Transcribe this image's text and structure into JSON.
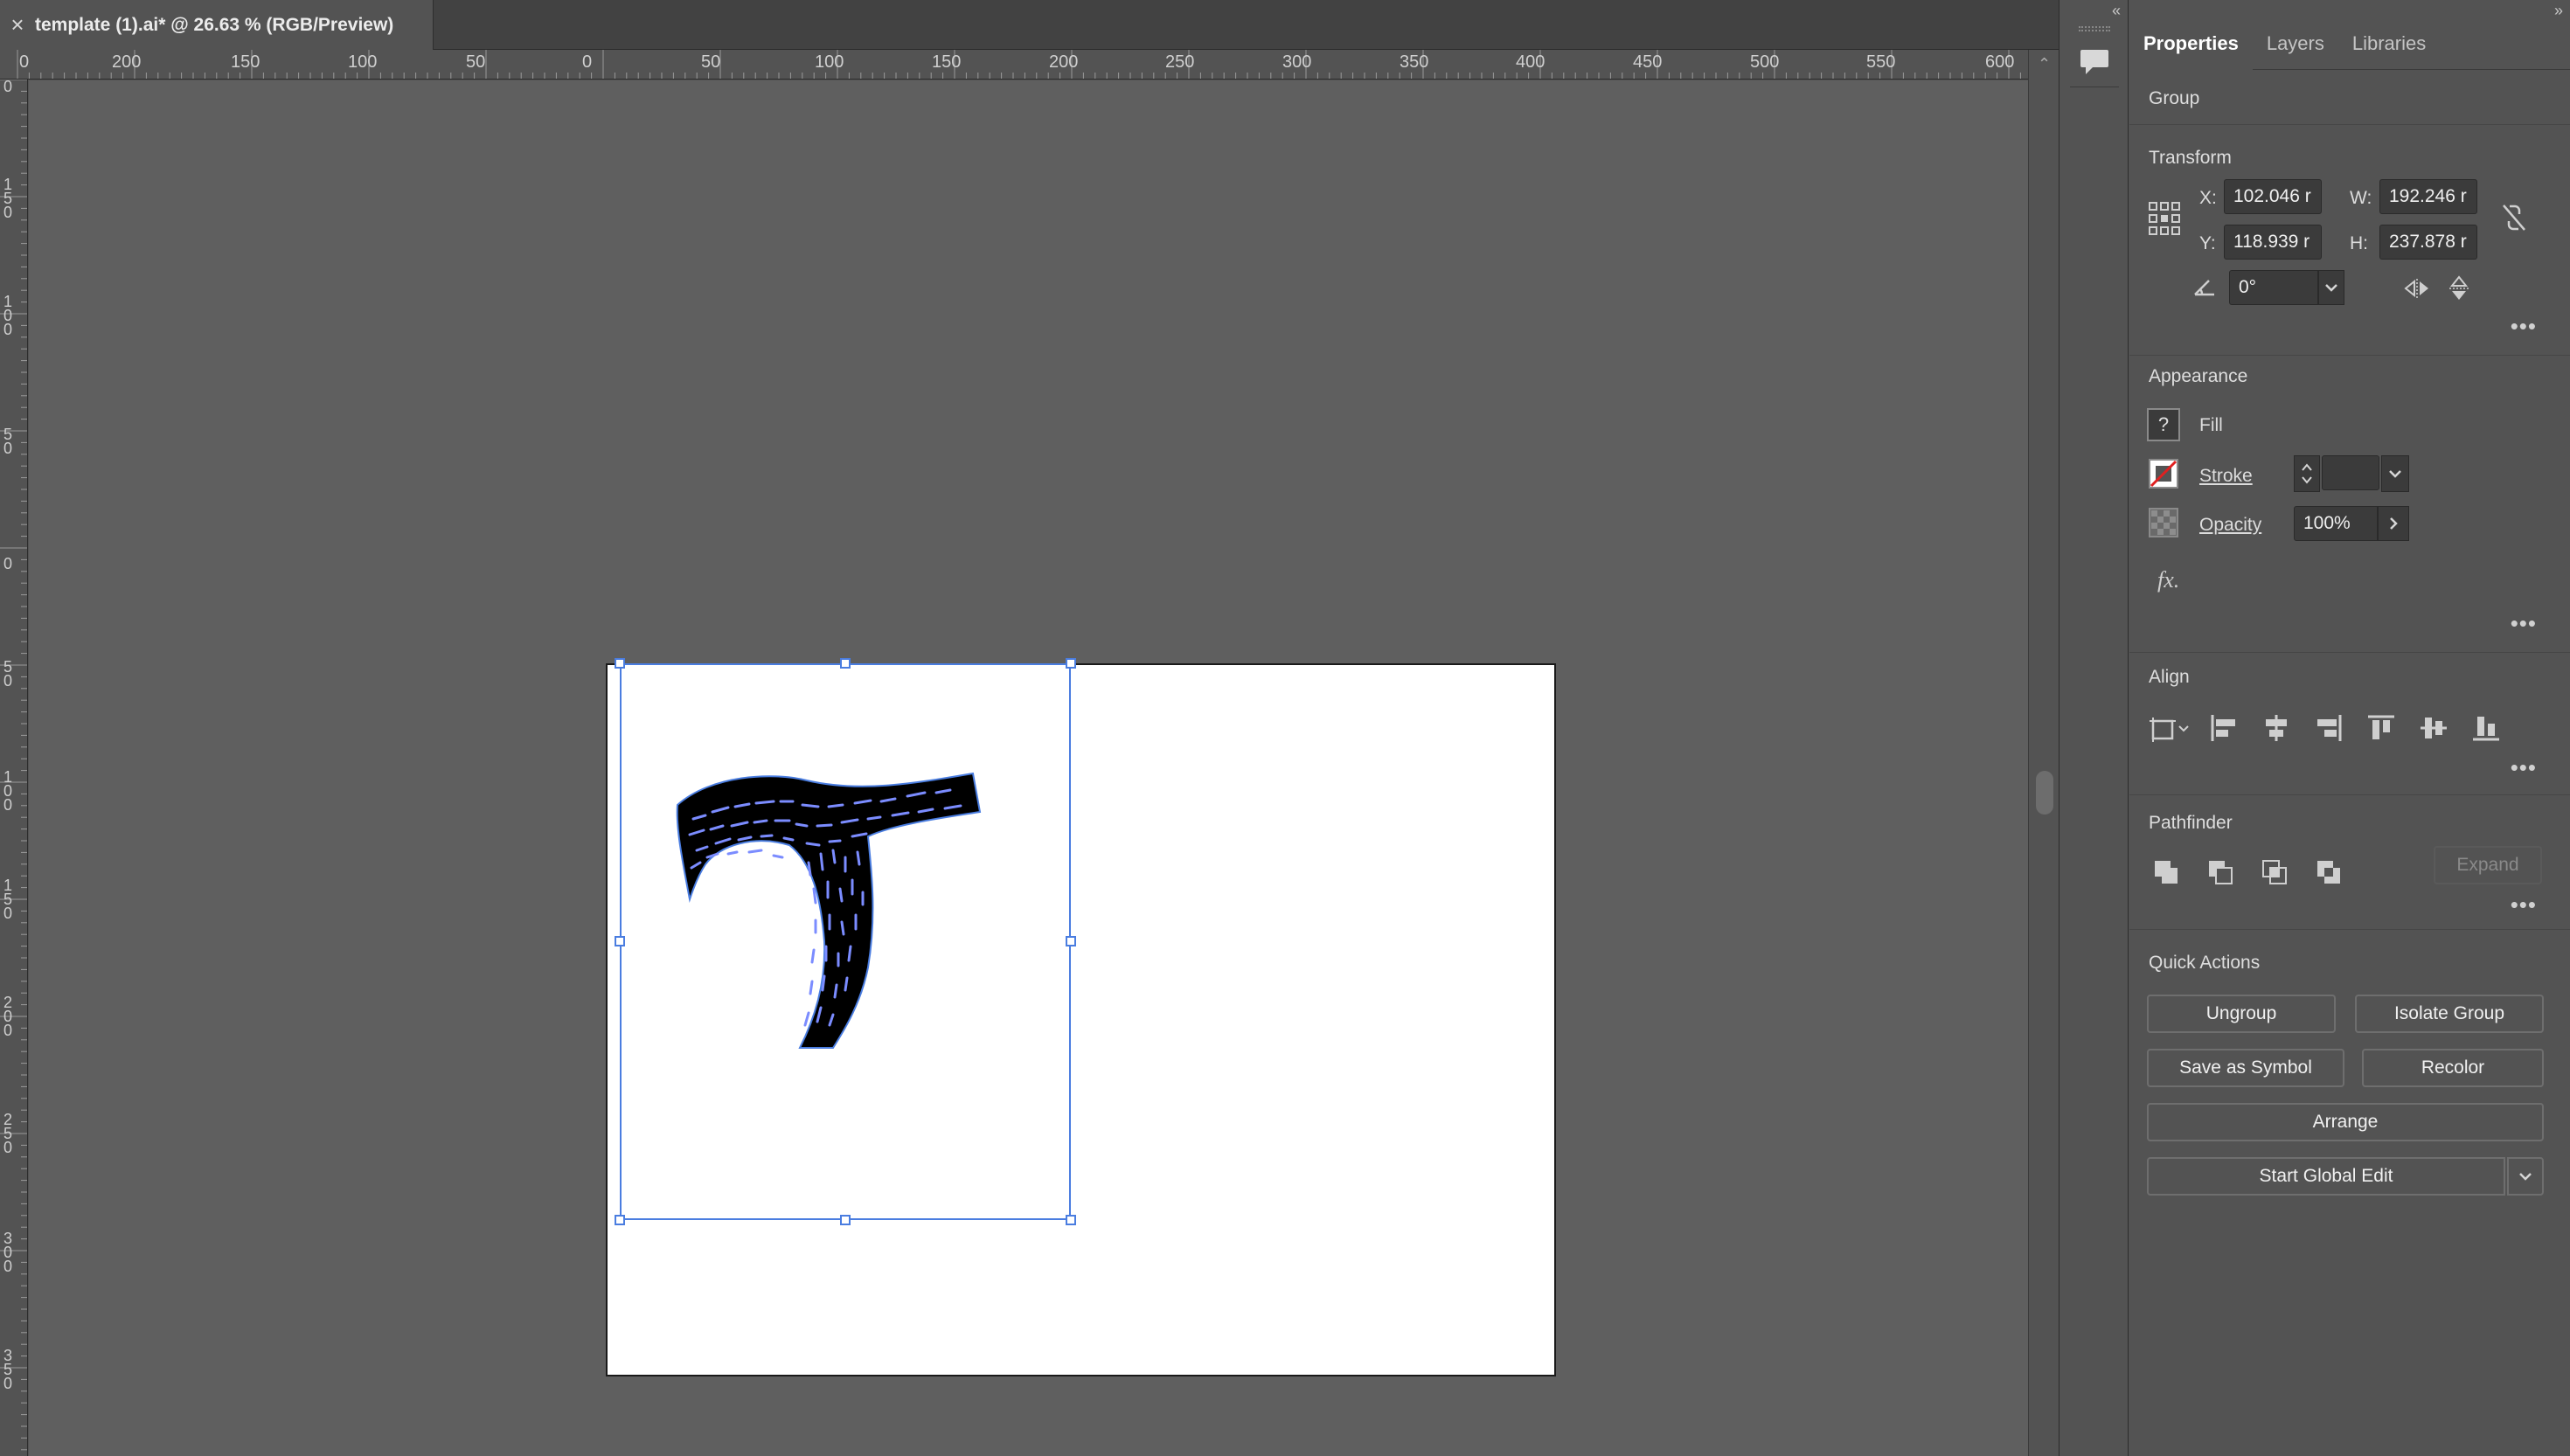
{
  "document_tab": {
    "close_glyph": "×",
    "title": "template (1).ai* @ 26.63 % (RGB/Preview)"
  },
  "rulers": {
    "horizontal": [
      "0",
      "200",
      "150",
      "100",
      "50",
      "0",
      "50",
      "100",
      "150",
      "200",
      "250",
      "300",
      "350",
      "400",
      "450",
      "500",
      "550",
      "600"
    ],
    "vertical": [
      "0",
      "150",
      "100",
      "50",
      "0",
      "50",
      "100",
      "150",
      "200",
      "250",
      "300",
      "350"
    ]
  },
  "canvas": {
    "artwork": "letter-t-icon",
    "artwork_color": "#000000",
    "hatch_color": "#7b8cff",
    "selection_color": "#4a7de0"
  },
  "panel": {
    "tabs": [
      "Properties",
      "Layers",
      "Libraries"
    ],
    "selection_type": "Group",
    "transform": {
      "title": "Transform",
      "x_label": "X:",
      "x_value": "102.046 r",
      "y_label": "Y:",
      "y_value": "118.939 r",
      "w_label": "W:",
      "w_value": "192.246 r",
      "h_label": "H:",
      "h_value": "237.878 r",
      "angle_value": "0°"
    },
    "appearance": {
      "title": "Appearance",
      "fill_label": "Fill",
      "fill_swatch": "?",
      "stroke_label": "Stroke",
      "opacity_label": "Opacity",
      "opacity_value": "100%",
      "fx_label": "fx."
    },
    "align": {
      "title": "Align"
    },
    "pathfinder": {
      "title": "Pathfinder",
      "expand_label": "Expand"
    },
    "quick_actions": {
      "title": "Quick Actions",
      "ungroup": "Ungroup",
      "isolate_group": "Isolate Group",
      "save_as_symbol": "Save as Symbol",
      "recolor": "Recolor",
      "arrange": "Arrange",
      "start_global_edit": "Start Global Edit"
    }
  }
}
